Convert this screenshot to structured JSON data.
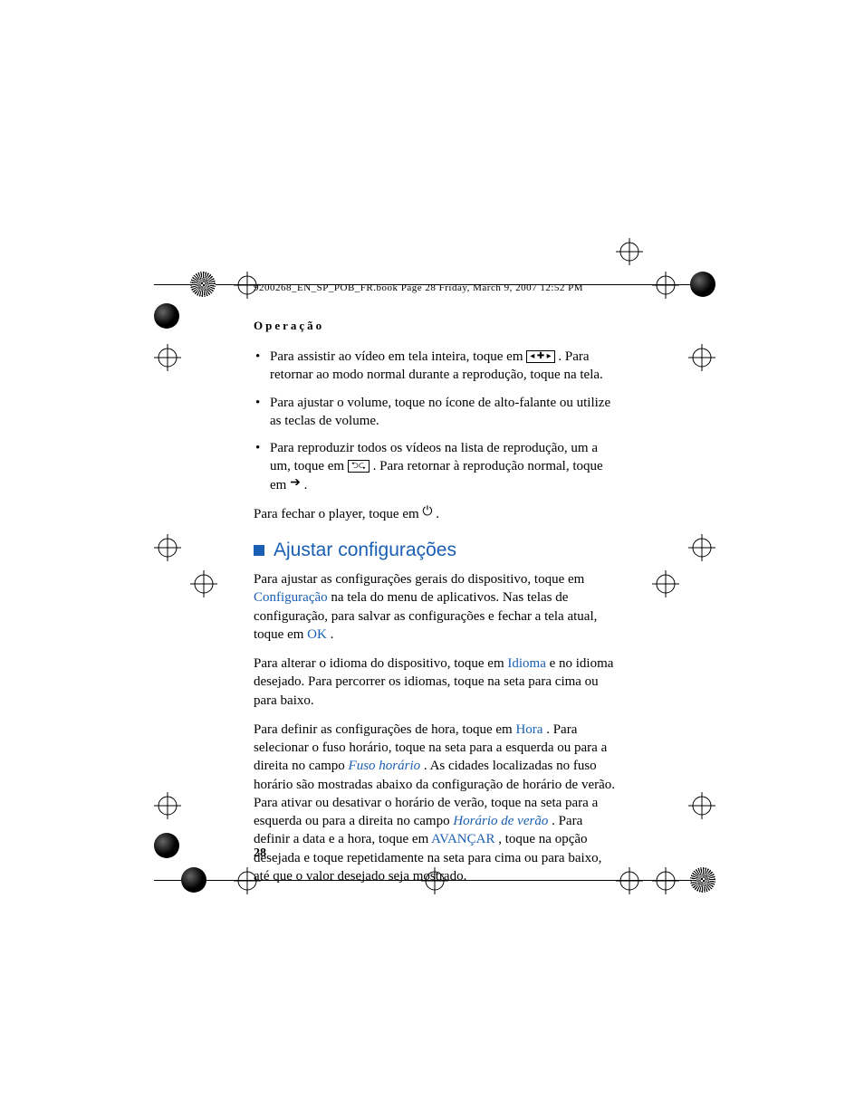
{
  "running_head": "9200268_EN_SP_POB_FR.book  Page 28  Friday, March 9, 2007  12:52 PM",
  "section_header": "Operação",
  "bullets": {
    "b1a": "Para assistir ao vídeo em tela inteira, toque em ",
    "b1b": ". Para retornar ao modo normal durante a reprodução, toque na tela.",
    "b2": "Para ajustar o volume, toque no ícone de alto-falante ou utilize as teclas de volume.",
    "b3a": "Para reproduzir todos os vídeos na lista de reprodução, um a um, toque em ",
    "b3b": ". Para retornar à reprodução normal, toque em ",
    "b3c": "."
  },
  "close_player_a": "Para fechar o player, toque em ",
  "close_player_b": ".",
  "heading": "Ajustar configurações",
  "p1a": "Para ajustar as configurações gerais do dispositivo, toque em ",
  "p1_link1": "Configuração",
  "p1b": " na tela do menu de aplicativos. Nas telas de configuração, para salvar as configurações e fechar a tela atual, toque em ",
  "p1_link2": "OK",
  "p1c": ".",
  "p2a": "Para alterar o idioma do dispositivo, toque em ",
  "p2_link1": "Idioma",
  "p2b": " e no idioma desejado. Para percorrer os idiomas, toque na seta para cima ou para baixo.",
  "p3a": "Para definir as configurações de hora, toque em ",
  "p3_link1": "Hora",
  "p3b": ". Para selecionar o fuso horário, toque na seta para a esquerda ou para a direita no campo ",
  "p3_link2": "Fuso horário",
  "p3c": ". As cidades localizadas no fuso horário são mostradas abaixo da configuração de horário de verão. Para ativar ou desativar o horário de verão, toque na seta para a esquerda ou para a direita no campo ",
  "p3_link3": "Horário de verão",
  "p3d": ". Para definir a data e a hora, toque em ",
  "p3_link4": "AVANÇAR",
  "p3e": ", toque na opção desejada e toque repetidamente na seta para cima ou para baixo, até que o valor desejado seja mostrado.",
  "page_number": "28",
  "icon_fullscreen": "◂ ✚ ▸",
  "icon_loop": "⮌⮎",
  "icon_arrow": "➔",
  "icon_power": "⏻"
}
